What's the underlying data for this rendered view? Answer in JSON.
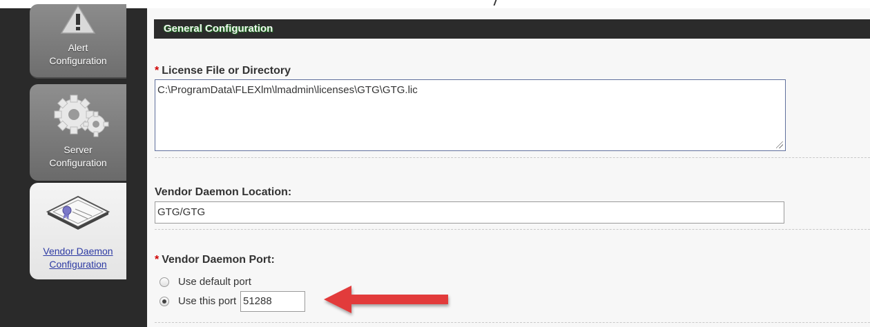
{
  "sidebar": {
    "tabs": [
      {
        "line1": "Alert",
        "line2": "Configuration",
        "icon": "warning-icon"
      },
      {
        "line1": "Server",
        "line2": "Configuration",
        "icon": "gears-icon"
      },
      {
        "line1": "Vendor Daemon",
        "line2": "Configuration",
        "icon": "certificate-icon",
        "active": true
      }
    ]
  },
  "main": {
    "section_title": "General Configuration",
    "license": {
      "required_marker": "*",
      "label": "License File or Directory",
      "value": "C:\\ProgramData\\FLEXlm\\lmadmin\\licenses\\GTG\\GTG.lic"
    },
    "vendor_location": {
      "label": "Vendor Daemon Location:",
      "value": "GTG/GTG"
    },
    "vendor_port": {
      "required_marker": "*",
      "label": "Vendor Daemon Port:",
      "options": [
        {
          "label": "Use default port",
          "checked": false
        },
        {
          "label": "Use this port",
          "checked": true
        }
      ],
      "port_value": "51288"
    }
  },
  "colors": {
    "accent_red_arrow": "#e23b3b",
    "required_marker": "#d00000",
    "link": "#2d3aa3",
    "header_bg": "#2b2b2b"
  }
}
